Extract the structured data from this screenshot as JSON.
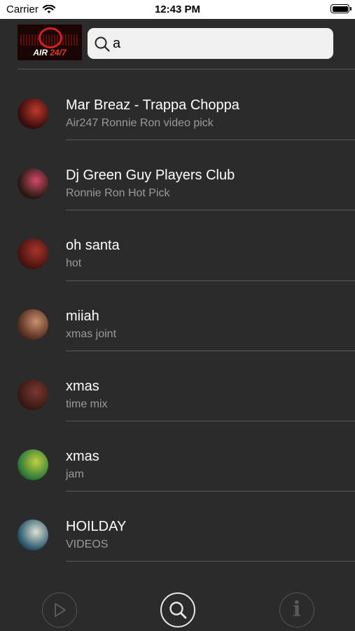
{
  "status_bar": {
    "carrier": "Carrier",
    "time": "12:43 PM"
  },
  "header": {
    "logo_text_1": "AIR ",
    "logo_text_2": "24/7",
    "search_value": "a"
  },
  "items": [
    {
      "title": "Mar Breaz - Trappa Choppa",
      "subtitle": "Air247 Ronnie Ron video pick",
      "thumb_colors": [
        "#3a0d0d",
        "#c0392b"
      ]
    },
    {
      "title": "Dj Green Guy Players Club",
      "subtitle": "Ronnie Ron Hot Pick",
      "thumb_colors": [
        "#2b1a12",
        "#d04a6a"
      ]
    },
    {
      "title": "oh santa",
      "subtitle": "hot",
      "thumb_colors": [
        "#4a1410",
        "#a8332c"
      ]
    },
    {
      "title": "miiah",
      "subtitle": "xmas joint",
      "thumb_colors": [
        "#5a3020",
        "#c89070"
      ]
    },
    {
      "title": "xmas",
      "subtitle": "time mix",
      "thumb_colors": [
        "#3a1a14",
        "#7a3830"
      ]
    },
    {
      "title": "xmas",
      "subtitle": "jam",
      "thumb_colors": [
        "#2f7a3a",
        "#c0d040"
      ]
    },
    {
      "title": "HOILDAY",
      "subtitle": "VIDEOS",
      "thumb_colors": [
        "#2a5a70",
        "#e0e0d0"
      ]
    }
  ],
  "tabs": {
    "play_icon": "play-icon",
    "search_icon": "search-icon",
    "info_icon": "info-icon",
    "info_glyph": "i"
  }
}
